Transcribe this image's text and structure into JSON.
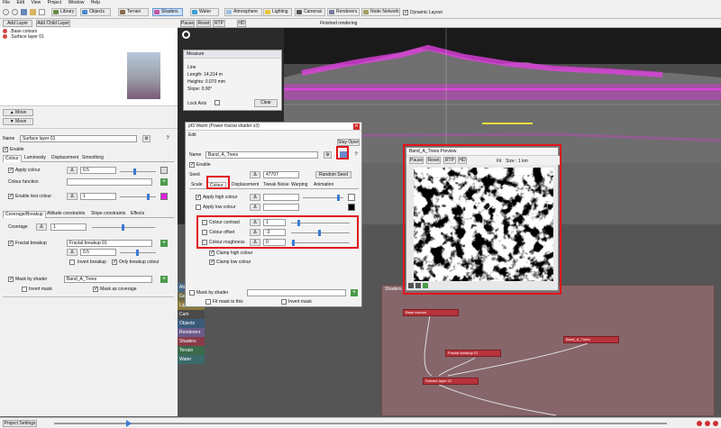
{
  "menu": [
    "File",
    "Edit",
    "View",
    "Project",
    "Window",
    "Help"
  ],
  "toolbar": {
    "library": "Library",
    "objects": "Objects",
    "terrain": "Terrain",
    "shaders": "Shaders",
    "water": "Water",
    "atmosphere": "Atmosphere",
    "lighting": "Lighting",
    "cameras": "Cameras",
    "renderers": "Renderers",
    "node_network": "Node Network",
    "dynamic_layout": "Dynamic Layout"
  },
  "layers_panel": {
    "add_layer": "Add Layer",
    "add_child_layer": "Add Child Layer",
    "size_label": "Size : 1 km",
    "items": [
      ".Base colours",
      ".Surface layer 01"
    ],
    "move_up": "Move",
    "move_down": "Move"
  },
  "view_toolbar": {
    "pause": "Pause",
    "reset": "Reset",
    "rtp": "RTP",
    "hd": "HD",
    "status": "Finished rendering"
  },
  "measure": {
    "title": "Measure",
    "line": "Line",
    "length": "Length: 14,314 m",
    "heights": "Heights: 0.070 mm",
    "slope": "Slope: 0.00°",
    "lock_axis": "Lock Axis",
    "clear": "Clear"
  },
  "surface_layer": {
    "name_label": "Name",
    "name_value": "Surface layer 01",
    "enable": "Enable",
    "tabs": [
      "Colour",
      "Luminosity",
      "Displacement",
      "Smoothing"
    ],
    "apply_colour": "Apply colour",
    "apply_colour_value": "0.5",
    "colour_function": "Colour function",
    "enable_test_colour": "Enable test colour",
    "test_colour_value": "1",
    "sub_tabs": [
      "Coverage/Breakup",
      "Altitude constraints",
      "Slope constraints",
      "Effects"
    ],
    "coverage": "Coverage",
    "coverage_value": "1",
    "fractal_breakup": "Fractal breakup",
    "fractal_breakup_value": "Fractal breakup 01",
    "fractal_num": "0.5",
    "invert_breakup": "Invert breakup",
    "only_breakup_colour": "Only breakup colour",
    "mask_by_shader": "Mask by shader",
    "mask_by_shader_value": "Band_A_Trees",
    "invert_mask": "Invert mask",
    "mask_as_coverage": "Mask as coverage"
  },
  "warp_dialog": {
    "title": "pf3 Warm   (Power fractal shader v3)",
    "edit": "Edit",
    "name_label": "Name",
    "name_value": "Band_A_Trees",
    "stay_open": "Stay Open",
    "enable": "Enable",
    "seed_label": "Seed",
    "seed_value": "47707",
    "random_seed": "Random Seed",
    "tabs": [
      "Scale",
      "Colour",
      "Displacement",
      "Tweak Noise",
      "Warping",
      "Animation"
    ],
    "apply_high_colour": "Apply high colour",
    "apply_low_colour": "Apply low colour",
    "colour_contrast": "Colour contrast",
    "colour_contrast_value": "1",
    "colour_offset": "Colour offset",
    "colour_offset_value": "-3",
    "colour_roughness": "Colour roughness",
    "colour_roughness_value": "0",
    "clamp_high": "Clamp high colour",
    "clamp_low": "Clamp low colour",
    "mask_by_shader": "Mask by shader",
    "fit_mask": "Fit mask to this",
    "invert_mask": "Invert mask"
  },
  "preview": {
    "title": "Band_A_Trees Preview",
    "pause": "Pause",
    "reset": "Reset",
    "rtp": "RTP",
    "hd": "HD",
    "fit": "Fit",
    "size": "Size : 1 km"
  },
  "node_network": {
    "group_label": "Shaders",
    "nodes": [
      "Base colours",
      "Fractal breakup 01",
      "Band_A_Trees",
      "Surface layer 01"
    ],
    "side_labels": [
      "Atm",
      "Ge",
      "Lig",
      "Cam",
      "Objects",
      "Renderers",
      "Shaders",
      "Terrain",
      "Water"
    ]
  },
  "status_bar": {
    "project_settings": "Project Settings"
  },
  "colors": {
    "accent": "#3a7bd5",
    "highlight": "#e0161b",
    "node": "#b8333b",
    "terrain_magenta": "#e040e0"
  }
}
